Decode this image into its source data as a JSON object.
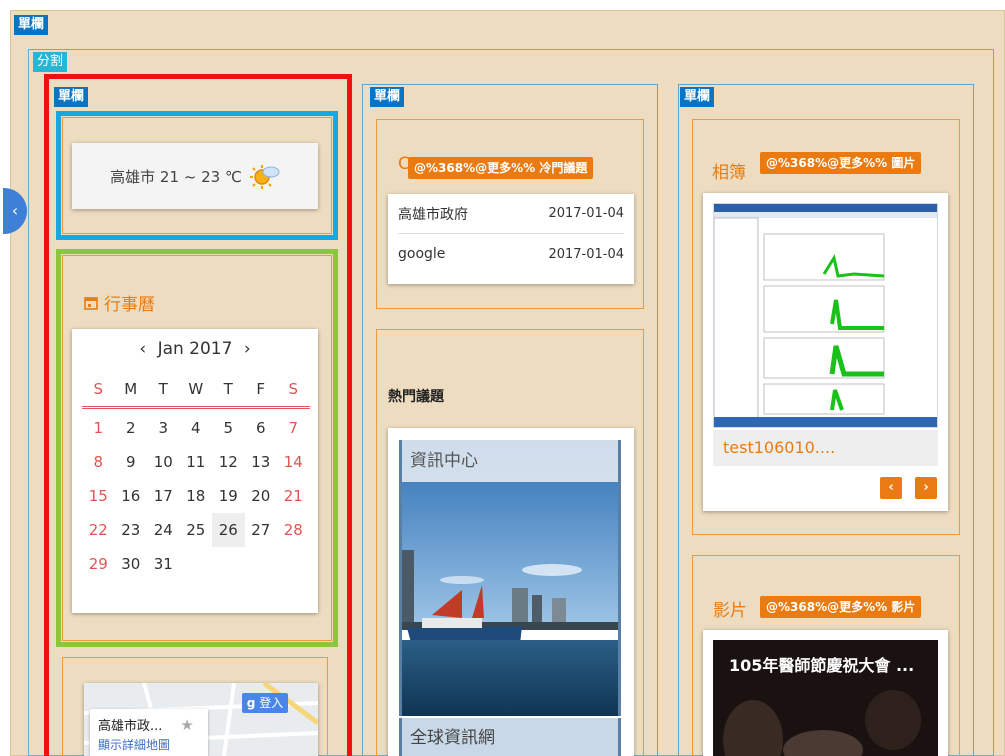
{
  "layout": {
    "outer_tag": "單欄",
    "split_tag": "分割",
    "col1_tag": "單欄",
    "col2_tag": "單欄",
    "col3_tag": "單欄"
  },
  "colors": {
    "beige": "#eddcbf",
    "orange": "#ea7b12",
    "blue_tag": "#0a74c4",
    "teal_tag": "#29b6d4",
    "red_border": "#ee1111",
    "cyan_border": "#17a8e2",
    "green_border": "#8cc63f"
  },
  "weather": {
    "text": "高雄市 21 ~ 23 ℃",
    "icon": "sun-cloud-icon"
  },
  "calendar": {
    "title": "行事曆",
    "month": "Jan 2017",
    "prev": "‹",
    "next": "›",
    "weekdays": [
      "S",
      "M",
      "T",
      "W",
      "T",
      "F",
      "S"
    ],
    "weeks": [
      [
        "1",
        "2",
        "3",
        "4",
        "5",
        "6",
        "7"
      ],
      [
        "8",
        "9",
        "10",
        "11",
        "12",
        "13",
        "14"
      ],
      [
        "15",
        "16",
        "17",
        "18",
        "19",
        "20",
        "21"
      ],
      [
        "22",
        "23",
        "24",
        "25",
        "26",
        "27",
        "28"
      ],
      [
        "29",
        "30",
        "31",
        "",
        "",
        "",
        ""
      ]
    ],
    "highlighted": "26"
  },
  "map": {
    "place": "高雄市政...",
    "link": "顯示詳細地圖",
    "login": "登入",
    "star": "★"
  },
  "cold_topics": {
    "button": "@%368%@更多%% 冷門議題",
    "rows": [
      {
        "name": "高雄市政府",
        "date": "2017-01-04"
      },
      {
        "name": "google",
        "date": "2017-01-04"
      }
    ]
  },
  "hot_topics": {
    "title": "熱門議題",
    "item1": "資訊中心",
    "item2": "全球資訊網"
  },
  "album": {
    "title": "相簿",
    "button": "@%368%@更多%% 圖片",
    "caption": "test106010....",
    "prev": "‹",
    "next": "›"
  },
  "video": {
    "title": "影片",
    "button": "@%368%@更多%% 影片",
    "caption": "105年醫師節慶祝大會 ..."
  },
  "side_toggle": "‹"
}
